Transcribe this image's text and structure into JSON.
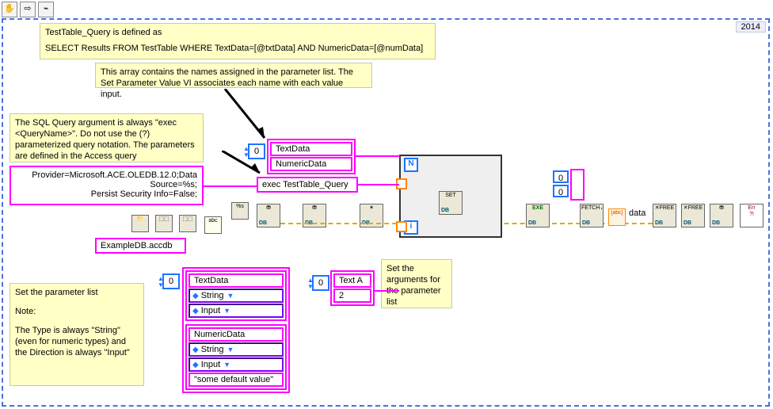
{
  "year": "2014",
  "toolbar": {
    "tool1": "✋",
    "tool2": "⇨",
    "tool3": "⌁"
  },
  "notes": {
    "sqldef1": "TestTable_Query is defined as",
    "sqldef2": "SELECT Results FROM TestTable WHERE TextData=[@txtData] AND NumericData=[@numData]",
    "arraynames": "This array contains the names assigned in the parameter list. The Set Parameter Value VI associates each name with each value input.",
    "execnote": "The SQL Query argument is always \"exec <QueryName>\". Do not use the (?) parameterized query notation. The parameters are defined in the Access query",
    "paramlist1": "Set the parameter list",
    "paramlist2": "Note:",
    "paramlist3": "The Type is always \"String\" (even for numeric types) and the Direction is always \"Input\"",
    "args": "Set the arguments for the parameter list"
  },
  "provider": {
    "line1": "Provider=Microsoft.ACE.OLEDB.12.0;Data",
    "line2": "Source=%s;",
    "line3": "Persist Security Info=False;"
  },
  "dbfile": "ExampleDB.accdb",
  "execcmd": "exec TestTable_Query",
  "paramNames": {
    "idx": "0",
    "n0": "TextData",
    "n1": "NumericData"
  },
  "paramList": {
    "idx": "0",
    "p0": {
      "name": "TextData",
      "type": "String",
      "dir": "Input",
      "default": ""
    },
    "p1": {
      "name": "NumericData",
      "type": "String",
      "dir": "Input",
      "default": "\"some default value\""
    }
  },
  "args": {
    "idx": "0",
    "v0": "Text A",
    "v1": "2"
  },
  "fetchCursor": {
    "idx": "0",
    "a": "0",
    "b": "0"
  },
  "forloop": {
    "N": "N",
    "i": "i"
  },
  "dataLabel": "data",
  "nodes": {
    "open": "Open",
    "create": "Create",
    "exec": "Exec",
    "setparam": "SET",
    "run": "EXE",
    "fetch": "FETCH ALL",
    "free1": "FREE",
    "free2": "FREE",
    "close": "Close",
    "err": "Err"
  }
}
